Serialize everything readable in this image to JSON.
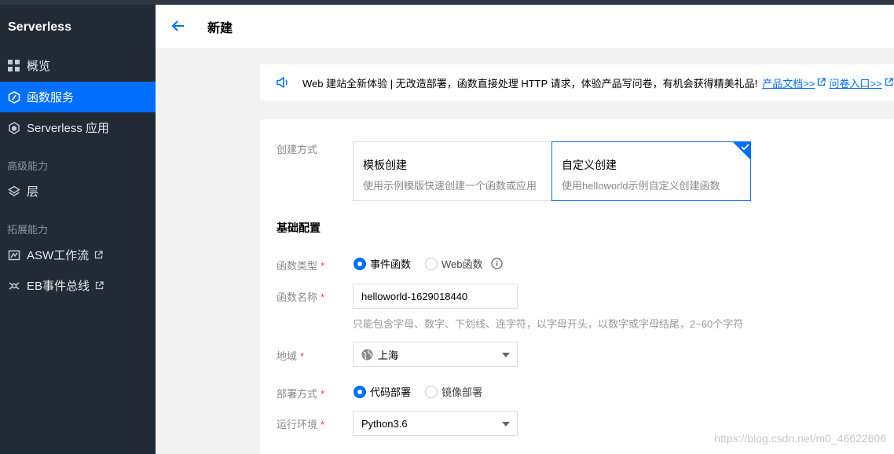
{
  "app": {
    "title": "Serverless"
  },
  "sidebar": {
    "items": [
      {
        "label": "概览",
        "icon": "grid-icon"
      },
      {
        "label": "函数服务",
        "icon": "function-icon",
        "active": true
      },
      {
        "label": "Serverless 应用",
        "icon": "cubes-icon"
      }
    ],
    "group_advanced": "高级能力",
    "advanced_items": [
      {
        "label": "层",
        "icon": "layers-icon"
      }
    ],
    "group_extend": "拓展能力",
    "extend_items": [
      {
        "label": "ASW工作流",
        "icon": "workflow-icon"
      },
      {
        "label": "EB事件总线",
        "icon": "eventbus-icon"
      }
    ]
  },
  "header": {
    "title": "新建"
  },
  "notice": {
    "text": "Web 建站全新体验 | 无改造部署，函数直接处理 HTTP 请求，体验产品写问卷，有机会获得精美礼品!",
    "link_docs": "产品文档>>",
    "link_survey": "问卷入口>>"
  },
  "form": {
    "create_method_label": "创建方式",
    "tiles": [
      {
        "title": "模板创建",
        "desc": "使用示例模版快速创建一个函数或应用",
        "selected": false
      },
      {
        "title": "自定义创建",
        "desc": "使用helloworld示例自定义创建函数",
        "selected": true
      }
    ],
    "section_basic": "基础配置",
    "function_type_label": "函数类型",
    "function_type_options": [
      "事件函数",
      "Web函数"
    ],
    "function_type_selected": "事件函数",
    "function_name_label": "函数名称",
    "function_name_value": "helloworld-1629018440",
    "function_name_hint": "只能包含字母、数字、下划线、连字符，以字母开头，以数字或字母结尾，2~60个字符",
    "region_label": "地域",
    "region_value": "上海",
    "deploy_label": "部署方式",
    "deploy_options": [
      "代码部署",
      "镜像部署"
    ],
    "deploy_selected": "代码部署",
    "runtime_label": "运行环境",
    "runtime_value": "Python3.6",
    "required_mark": "*"
  },
  "watermark": "https://blog.csdn.net/m0_46622606",
  "colors": {
    "accent": "#006eff",
    "sidebar_bg": "#222a35",
    "required": "#e54545"
  }
}
